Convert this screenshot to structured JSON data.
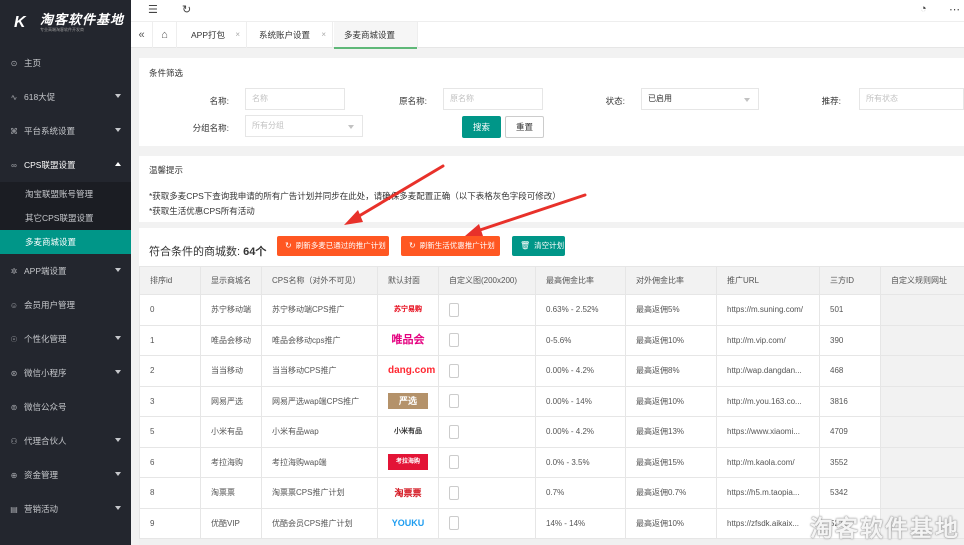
{
  "brand": {
    "name": "淘客软件基地",
    "tagline": "专业高端淘客软件开发商"
  },
  "sidebar": {
    "items": [
      {
        "label": "主页",
        "icon": "home-icon",
        "glyph": "⊙",
        "has_caret": false
      },
      {
        "label": "618大促",
        "icon": "pulse-icon",
        "glyph": "∿",
        "has_caret": true
      },
      {
        "label": "平台系统设置",
        "icon": "settings-icon",
        "glyph": "⌘",
        "has_caret": true
      },
      {
        "label": "CPS联盟设置",
        "icon": "link-icon",
        "glyph": "∞",
        "has_caret": true,
        "open": true
      },
      {
        "label": "APP端设置",
        "icon": "gear-icon",
        "glyph": "✲",
        "has_caret": true
      },
      {
        "label": "会员用户管理",
        "icon": "user-icon",
        "glyph": "☺",
        "has_caret": false
      },
      {
        "label": "个性化管理",
        "icon": "palette-icon",
        "glyph": "☉",
        "has_caret": true
      },
      {
        "label": "微信小程序",
        "icon": "miniprogram-icon",
        "glyph": "⊛",
        "has_caret": true
      },
      {
        "label": "微信公众号",
        "icon": "wechat-icon",
        "glyph": "⊚",
        "has_caret": false
      },
      {
        "label": "代理合伙人",
        "icon": "partner-icon",
        "glyph": "⚇",
        "has_caret": true
      },
      {
        "label": "资金管理",
        "icon": "money-icon",
        "glyph": "⊕",
        "has_caret": true
      },
      {
        "label": "营销活动",
        "icon": "campaign-icon",
        "glyph": "▤",
        "has_caret": true
      }
    ],
    "submenu": [
      {
        "label": "淘宝联盟账号管理"
      },
      {
        "label": "其它CPS联盟设置"
      },
      {
        "label": "多麦商城设置",
        "active": true
      }
    ]
  },
  "topbar": {
    "menu_icon": "☰",
    "refresh_icon": "↻",
    "theme_icon": "◔",
    "more_icon": "⋯"
  },
  "tabs": {
    "prev_icon": "«",
    "home_icon": "⌂",
    "close_icon": "×",
    "items": [
      {
        "label": "APP打包"
      },
      {
        "label": "系统账户设置"
      },
      {
        "label": "多麦商城设置",
        "active": true
      }
    ]
  },
  "filter": {
    "title": "条件筛选",
    "name_label": "名称:",
    "name_placeholder": "名称",
    "origname_label": "原名称:",
    "origname_placeholder": "原名称",
    "status_label": "状态:",
    "status_value": "已启用",
    "recommend_label": "推荐:",
    "recommend_placeholder": "所有状态",
    "group_label": "分组名称:",
    "group_placeholder": "所有分组",
    "search_label": "搜索",
    "reset_label": "重置"
  },
  "tips": {
    "title": "温馨提示",
    "line1": "*获取多麦CPS下查询我申请的所有广告计划并同步在此处，请确保多麦配置正确（以下表格灰色字段可修改）",
    "line2": "*获取生活优惠CPS所有活动"
  },
  "result": {
    "count_label": "符合条件的商城数:",
    "count_value": "64个",
    "btn_refresh_duomai": "刷新多麦已通过的推广计划",
    "btn_refresh_life": "刷新生活优惠推广计划",
    "btn_clear": "清空计划",
    "refresh_icon": "↻",
    "trash_icon": "🗑"
  },
  "table": {
    "headers": [
      "排序id",
      "显示商城名",
      "CPS名称（对外不可见）",
      "默认封面",
      "自定义图(200x200)",
      "最高佣金比率",
      "对外佣金比率",
      "推广URL",
      "三方ID",
      "自定义规则网址"
    ],
    "rows": [
      {
        "id": "0",
        "name": "苏宁移动端",
        "cps": "苏宁移动端CPS推广",
        "cover": "苏宁易购",
        "rate": "0.63% - 2.52%",
        "ext": "最高返佣5%",
        "url": "https://m.suning.com/",
        "tid": "501"
      },
      {
        "id": "1",
        "name": "唯品会移动",
        "cps": "唯品会移动cps推广",
        "cover": "唯品会",
        "rate": "0-5.6%",
        "ext": "最高返佣10%",
        "url": "http://m.vip.com/",
        "tid": "390"
      },
      {
        "id": "2",
        "name": "当当移动",
        "cps": "当当移动CPS推广",
        "cover": "dang.com",
        "rate": "0.00% - 4.2%",
        "ext": "最高返佣8%",
        "url": "http://wap.dangdan...",
        "tid": "468"
      },
      {
        "id": "3",
        "name": "网易严选",
        "cps": "网易严选wap端CPS推广",
        "cover": "严选",
        "rate": "0.00% - 14%",
        "ext": "最高返佣10%",
        "url": "http://m.you.163.co...",
        "tid": "3816"
      },
      {
        "id": "5",
        "name": "小米有品",
        "cps": "小米有品wap",
        "cover": "小米有品",
        "rate": "0.00% - 4.2%",
        "ext": "最高返佣13%",
        "url": "https://www.xiaomi...",
        "tid": "4709"
      },
      {
        "id": "6",
        "name": "考拉海购",
        "cps": "考拉海购wap端",
        "cover": "考拉海购",
        "rate": "0.0% - 3.5%",
        "ext": "最高返佣15%",
        "url": "http://m.kaola.com/",
        "tid": "3552"
      },
      {
        "id": "8",
        "name": "淘票票",
        "cps": "淘票票CPS推广计划",
        "cover": "淘票票",
        "rate": "0.7%",
        "ext": "最高返佣0.7%",
        "url": "https://h5.m.taopia...",
        "tid": "5342"
      },
      {
        "id": "9",
        "name": "优酷VIP",
        "cps": "优酷会员CPS推广计划",
        "cover": "YOUKU",
        "rate": "14% - 14%",
        "ext": "最高返佣10%",
        "url": "https://zfsdk.aikaix...",
        "tid": "5211"
      }
    ]
  },
  "watermark": "淘客软件基地",
  "colors": {
    "sidebar_bg": "#23262e",
    "accent": "#009688",
    "orange": "#ff5722",
    "annotation_arrow": "#e8312a"
  }
}
